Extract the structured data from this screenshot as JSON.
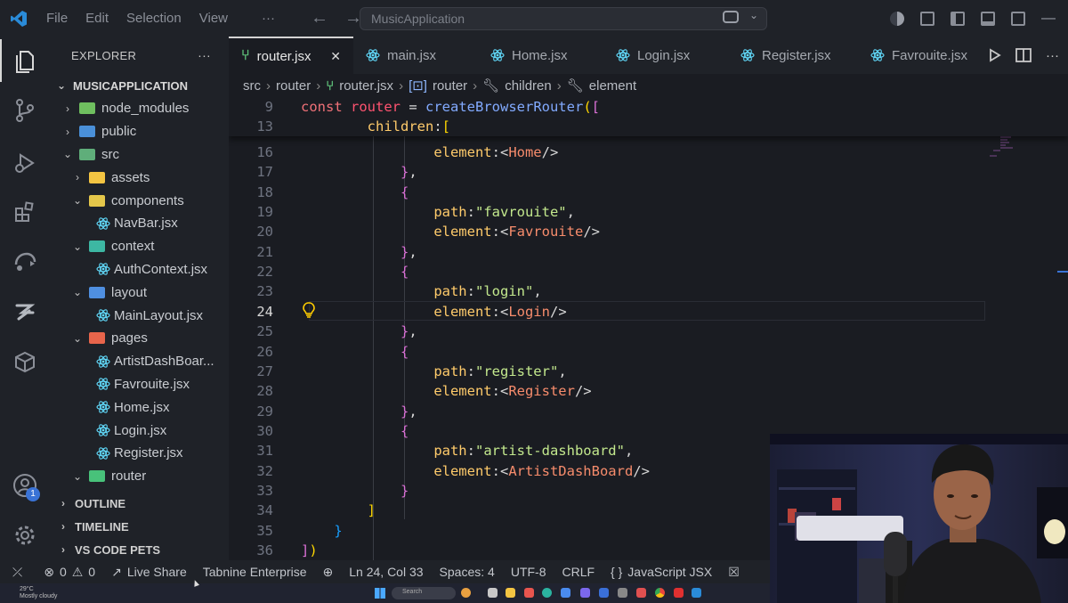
{
  "window": {
    "menu": [
      "File",
      "Edit",
      "Selection",
      "View"
    ],
    "menu_more": "···",
    "search_text": "MusicApplication"
  },
  "sidebar": {
    "title": "EXPLORER",
    "more": "···",
    "root": "MUSICAPPLICATION",
    "tree": [
      {
        "label": "node_modules",
        "kind": "folder",
        "depth": 1,
        "expanded": false,
        "color": "#6fbf5f"
      },
      {
        "label": "public",
        "kind": "folder",
        "depth": 1,
        "expanded": false,
        "color": "#4a90d9"
      },
      {
        "label": "src",
        "kind": "folder",
        "depth": 1,
        "expanded": true,
        "color": "#5fae7a"
      },
      {
        "label": "assets",
        "kind": "folder",
        "depth": 2,
        "expanded": false,
        "color": "#f4c542"
      },
      {
        "label": "components",
        "kind": "folder",
        "depth": 2,
        "expanded": true,
        "color": "#e5c74a"
      },
      {
        "label": "NavBar.jsx",
        "kind": "react",
        "depth": 3
      },
      {
        "label": "context",
        "kind": "folder",
        "depth": 2,
        "expanded": true,
        "color": "#3db7a3"
      },
      {
        "label": "AuthContext.jsx",
        "kind": "react",
        "depth": 3
      },
      {
        "label": "layout",
        "kind": "folder",
        "depth": 2,
        "expanded": true,
        "color": "#4f8fe0"
      },
      {
        "label": "MainLayout.jsx",
        "kind": "react",
        "depth": 3
      },
      {
        "label": "pages",
        "kind": "folder",
        "depth": 2,
        "expanded": true,
        "color": "#e8654b"
      },
      {
        "label": "ArtistDashBoar...",
        "kind": "react",
        "depth": 3
      },
      {
        "label": "Favrouite.jsx",
        "kind": "react",
        "depth": 3
      },
      {
        "label": "Home.jsx",
        "kind": "react",
        "depth": 3
      },
      {
        "label": "Login.jsx",
        "kind": "react",
        "depth": 3
      },
      {
        "label": "Register.jsx",
        "kind": "react",
        "depth": 3
      },
      {
        "label": "router",
        "kind": "folder",
        "depth": 2,
        "expanded": true,
        "color": "#48c27a"
      }
    ],
    "sections": [
      "OUTLINE",
      "TIMELINE",
      "VS CODE PETS"
    ]
  },
  "activity_badge": "1",
  "tabs": [
    {
      "label": "router.jsx",
      "active": true,
      "icon": "router-icon"
    },
    {
      "label": "main.jsx",
      "active": false,
      "icon": "react-icon"
    },
    {
      "label": "Home.jsx",
      "active": false,
      "icon": "react-icon"
    },
    {
      "label": "Login.jsx",
      "active": false,
      "icon": "react-icon"
    },
    {
      "label": "Register.jsx",
      "active": false,
      "icon": "react-icon"
    },
    {
      "label": "Favrouite.jsx",
      "active": false,
      "icon": "react-icon"
    }
  ],
  "breadcrumb": [
    "src",
    "router",
    "router.jsx",
    "router",
    "children",
    "element"
  ],
  "code": {
    "sticky": [
      {
        "n": "9",
        "segs": [
          [
            "kw",
            "const "
          ],
          [
            "var",
            "router"
          ],
          [
            "jsx",
            " = "
          ],
          [
            "fn",
            "createBrowserRouter"
          ],
          [
            "b1",
            "("
          ],
          [
            "b2",
            "["
          ]
        ]
      },
      {
        "n": "13",
        "segs": [
          [
            "jsx",
            "        "
          ],
          [
            "prop",
            "children"
          ],
          [
            "jsx",
            ":"
          ],
          [
            "b1",
            "["
          ]
        ]
      }
    ],
    "lines": [
      {
        "n": "16",
        "segs": [
          [
            "jsx",
            "                "
          ],
          [
            "prop",
            "element"
          ],
          [
            "jsx",
            ":<"
          ],
          [
            "tag",
            "Home"
          ],
          [
            "jsx",
            "/>"
          ]
        ]
      },
      {
        "n": "17",
        "segs": [
          [
            "jsx",
            "            "
          ],
          [
            "b2",
            "}"
          ],
          [
            "jsx",
            ","
          ]
        ]
      },
      {
        "n": "18",
        "segs": [
          [
            "jsx",
            "            "
          ],
          [
            "b2",
            "{"
          ]
        ]
      },
      {
        "n": "19",
        "segs": [
          [
            "jsx",
            "                "
          ],
          [
            "prop",
            "path"
          ],
          [
            "jsx",
            ":"
          ],
          [
            "str",
            "\"favrouite\""
          ],
          [
            "jsx",
            ","
          ]
        ]
      },
      {
        "n": "20",
        "segs": [
          [
            "jsx",
            "                "
          ],
          [
            "prop",
            "element"
          ],
          [
            "jsx",
            ":<"
          ],
          [
            "tag",
            "Favrouite"
          ],
          [
            "jsx",
            "/>"
          ]
        ]
      },
      {
        "n": "21",
        "segs": [
          [
            "jsx",
            "            "
          ],
          [
            "b2",
            "}"
          ],
          [
            "jsx",
            ","
          ]
        ]
      },
      {
        "n": "22",
        "segs": [
          [
            "jsx",
            "            "
          ],
          [
            "b2",
            "{"
          ]
        ]
      },
      {
        "n": "23",
        "segs": [
          [
            "jsx",
            "                "
          ],
          [
            "prop",
            "path"
          ],
          [
            "jsx",
            ":"
          ],
          [
            "str",
            "\"login\""
          ],
          [
            "jsx",
            ","
          ]
        ]
      },
      {
        "n": "24",
        "segs": [
          [
            "jsx",
            "                "
          ],
          [
            "prop",
            "element"
          ],
          [
            "jsx",
            ":<"
          ],
          [
            "tag",
            "Login"
          ],
          [
            "jsx",
            "/>"
          ]
        ]
      },
      {
        "n": "25",
        "segs": [
          [
            "jsx",
            "            "
          ],
          [
            "b2",
            "}"
          ],
          [
            "jsx",
            ","
          ]
        ]
      },
      {
        "n": "26",
        "segs": [
          [
            "jsx",
            "            "
          ],
          [
            "b2",
            "{"
          ]
        ]
      },
      {
        "n": "27",
        "segs": [
          [
            "jsx",
            "                "
          ],
          [
            "prop",
            "path"
          ],
          [
            "jsx",
            ":"
          ],
          [
            "str",
            "\"register\""
          ],
          [
            "jsx",
            ","
          ]
        ]
      },
      {
        "n": "28",
        "segs": [
          [
            "jsx",
            "                "
          ],
          [
            "prop",
            "element"
          ],
          [
            "jsx",
            ":<"
          ],
          [
            "tag",
            "Register"
          ],
          [
            "jsx",
            "/>"
          ]
        ]
      },
      {
        "n": "29",
        "segs": [
          [
            "jsx",
            "            "
          ],
          [
            "b2",
            "}"
          ],
          [
            "jsx",
            ","
          ]
        ]
      },
      {
        "n": "30",
        "segs": [
          [
            "jsx",
            "            "
          ],
          [
            "b2",
            "{"
          ]
        ]
      },
      {
        "n": "31",
        "segs": [
          [
            "jsx",
            "                "
          ],
          [
            "prop",
            "path"
          ],
          [
            "jsx",
            ":"
          ],
          [
            "str",
            "\"artist-dashboard\""
          ],
          [
            "jsx",
            ","
          ]
        ]
      },
      {
        "n": "32",
        "segs": [
          [
            "jsx",
            "                "
          ],
          [
            "prop",
            "element"
          ],
          [
            "jsx",
            ":<"
          ],
          [
            "tag",
            "ArtistDashBoard"
          ],
          [
            "jsx",
            "/>"
          ]
        ]
      },
      {
        "n": "33",
        "segs": [
          [
            "jsx",
            "            "
          ],
          [
            "b2",
            "}"
          ]
        ]
      },
      {
        "n": "34",
        "segs": [
          [
            "jsx",
            "        "
          ],
          [
            "b1",
            "]"
          ]
        ]
      },
      {
        "n": "35",
        "segs": [
          [
            "jsx",
            "    "
          ],
          [
            "b3",
            "}"
          ]
        ]
      },
      {
        "n": "36",
        "segs": [
          [
            "b2",
            "]"
          ],
          [
            "b1",
            ")"
          ]
        ]
      }
    ],
    "current_line": "24"
  },
  "status": {
    "errors": "0",
    "warnings": "0",
    "live_share": "Live Share",
    "tabnine": "Tabnine Enterprise",
    "position": "Ln 24, Col 33",
    "spaces": "Spaces: 4",
    "encoding": "UTF-8",
    "eol": "CRLF",
    "language": "JavaScript JSX"
  },
  "taskbar": {
    "temp": "29°C",
    "weather": "Mostly cloudy",
    "search": "Search"
  }
}
